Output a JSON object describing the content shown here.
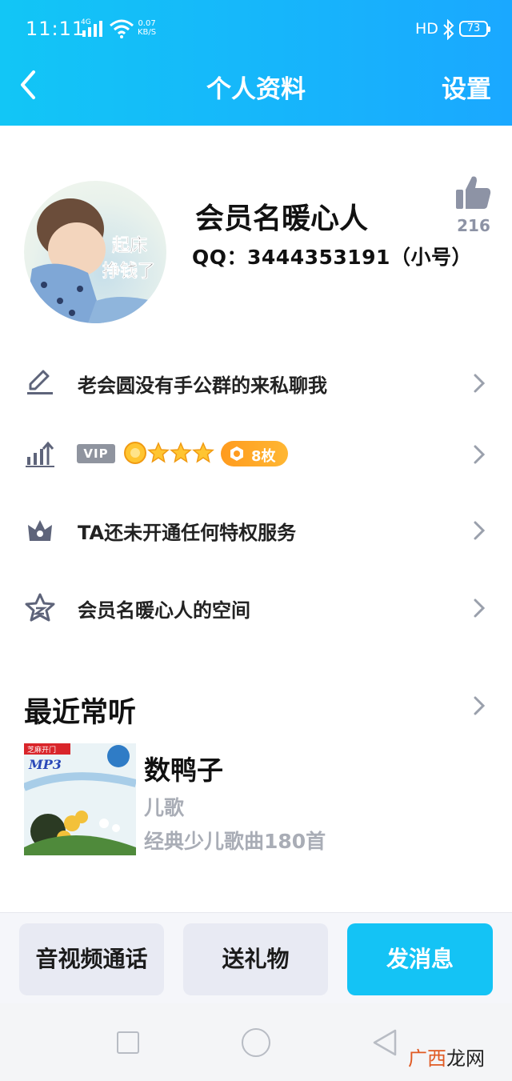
{
  "status_bar": {
    "time": "11:11",
    "network": "4G",
    "speed_value": "0.07",
    "speed_unit": "KB/S",
    "hd": "HD",
    "battery": "73"
  },
  "header": {
    "title": "个人资料",
    "settings_label": "设置",
    "background_color": "#1aa8ff"
  },
  "profile": {
    "nickname": "会员名暖心人",
    "qq_line": "QQ：3444353191（小号）",
    "avatar_text": "起床\n挣钱了",
    "like_count": "216"
  },
  "rows": [
    {
      "icon": "pencil-icon",
      "text": "老会圆没有手公群的来私聊我"
    },
    {
      "icon": "level-chart-icon",
      "vip_label": "VIP",
      "stars": 3,
      "coin_label": "8枚"
    },
    {
      "icon": "privilege-crown-icon",
      "text": "TA还未开通任何特权服务"
    },
    {
      "icon": "qzone-star-icon",
      "text": "会员名暖心人的空间"
    }
  ],
  "recent": {
    "title": "最近常听",
    "song": {
      "title": "数鸭子",
      "artist": "儿歌",
      "album": "经典少儿歌曲180首",
      "cover_badge": "芝麻开门",
      "cover_mp3": "MP3"
    }
  },
  "actions": {
    "call_label": "音视频通话",
    "gift_label": "送礼物",
    "message_label": "发消息",
    "accent_color": "#14c3f5"
  },
  "watermark": {
    "part1": "广西",
    "part2": "龙网"
  }
}
